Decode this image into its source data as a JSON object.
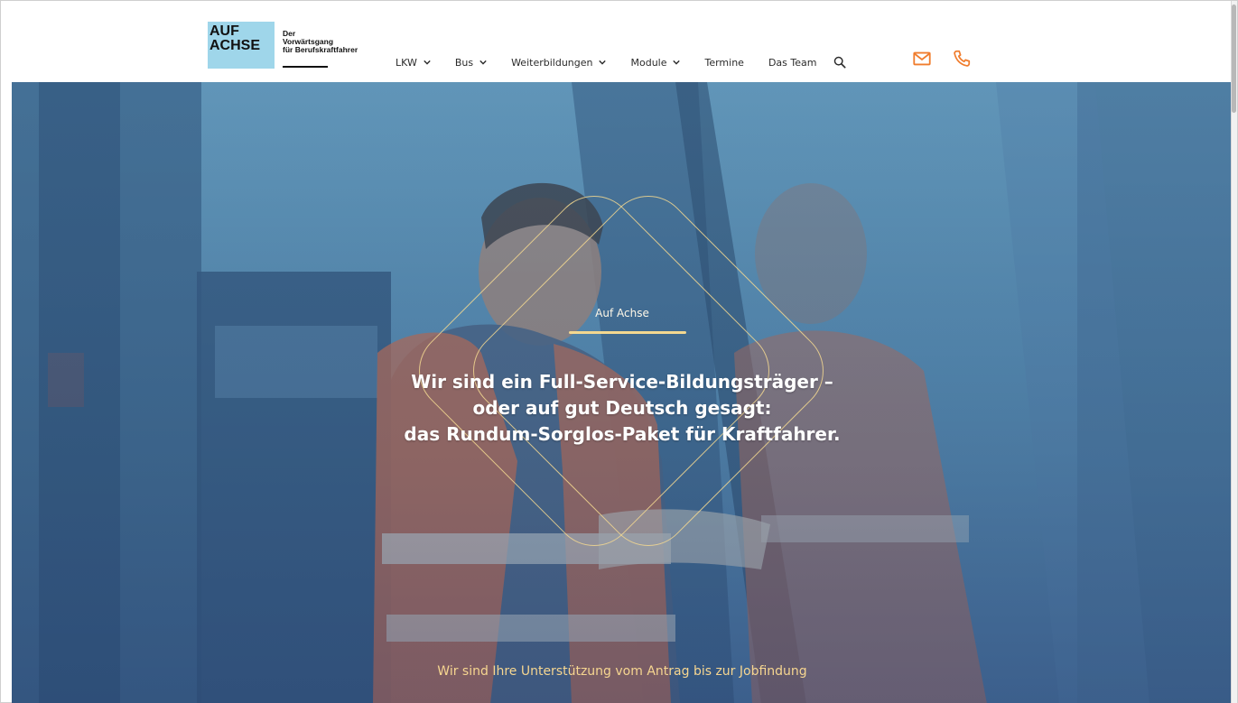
{
  "header": {
    "logo": {
      "main_line1": "AUF",
      "main_line2": "ACHSE",
      "sub_line1": "Der",
      "sub_line2": "Vorwärtsgang",
      "sub_line3": "für Berufskraftfahrer"
    },
    "nav": [
      {
        "label": "LKW",
        "has_dropdown": true
      },
      {
        "label": "Bus",
        "has_dropdown": true
      },
      {
        "label": "Weiterbildungen",
        "has_dropdown": true
      },
      {
        "label": "Module",
        "has_dropdown": true
      },
      {
        "label": "Termine",
        "has_dropdown": false
      },
      {
        "label": "Das Team",
        "has_dropdown": false
      }
    ],
    "icons": {
      "search": "search-icon",
      "mail": "mail-icon",
      "phone": "phone-icon"
    }
  },
  "hero": {
    "label": "Auf Achse",
    "title_line1": "Wir sind ein Full-Service-Bildungsträger –",
    "title_line2": "oder auf gut Deutsch gesagt:",
    "title_line3": "das Rundum-Sorglos-Paket für Kraftfahrer.",
    "subtitle": "Wir sind Ihre Unterstützung vom Antrag bis zur Jobfindung"
  },
  "colors": {
    "accent": "#f07d2e",
    "logo_bg": "#9fd6ea",
    "hero_gold": "#f3d890",
    "text_dark": "#2b2b2b"
  }
}
